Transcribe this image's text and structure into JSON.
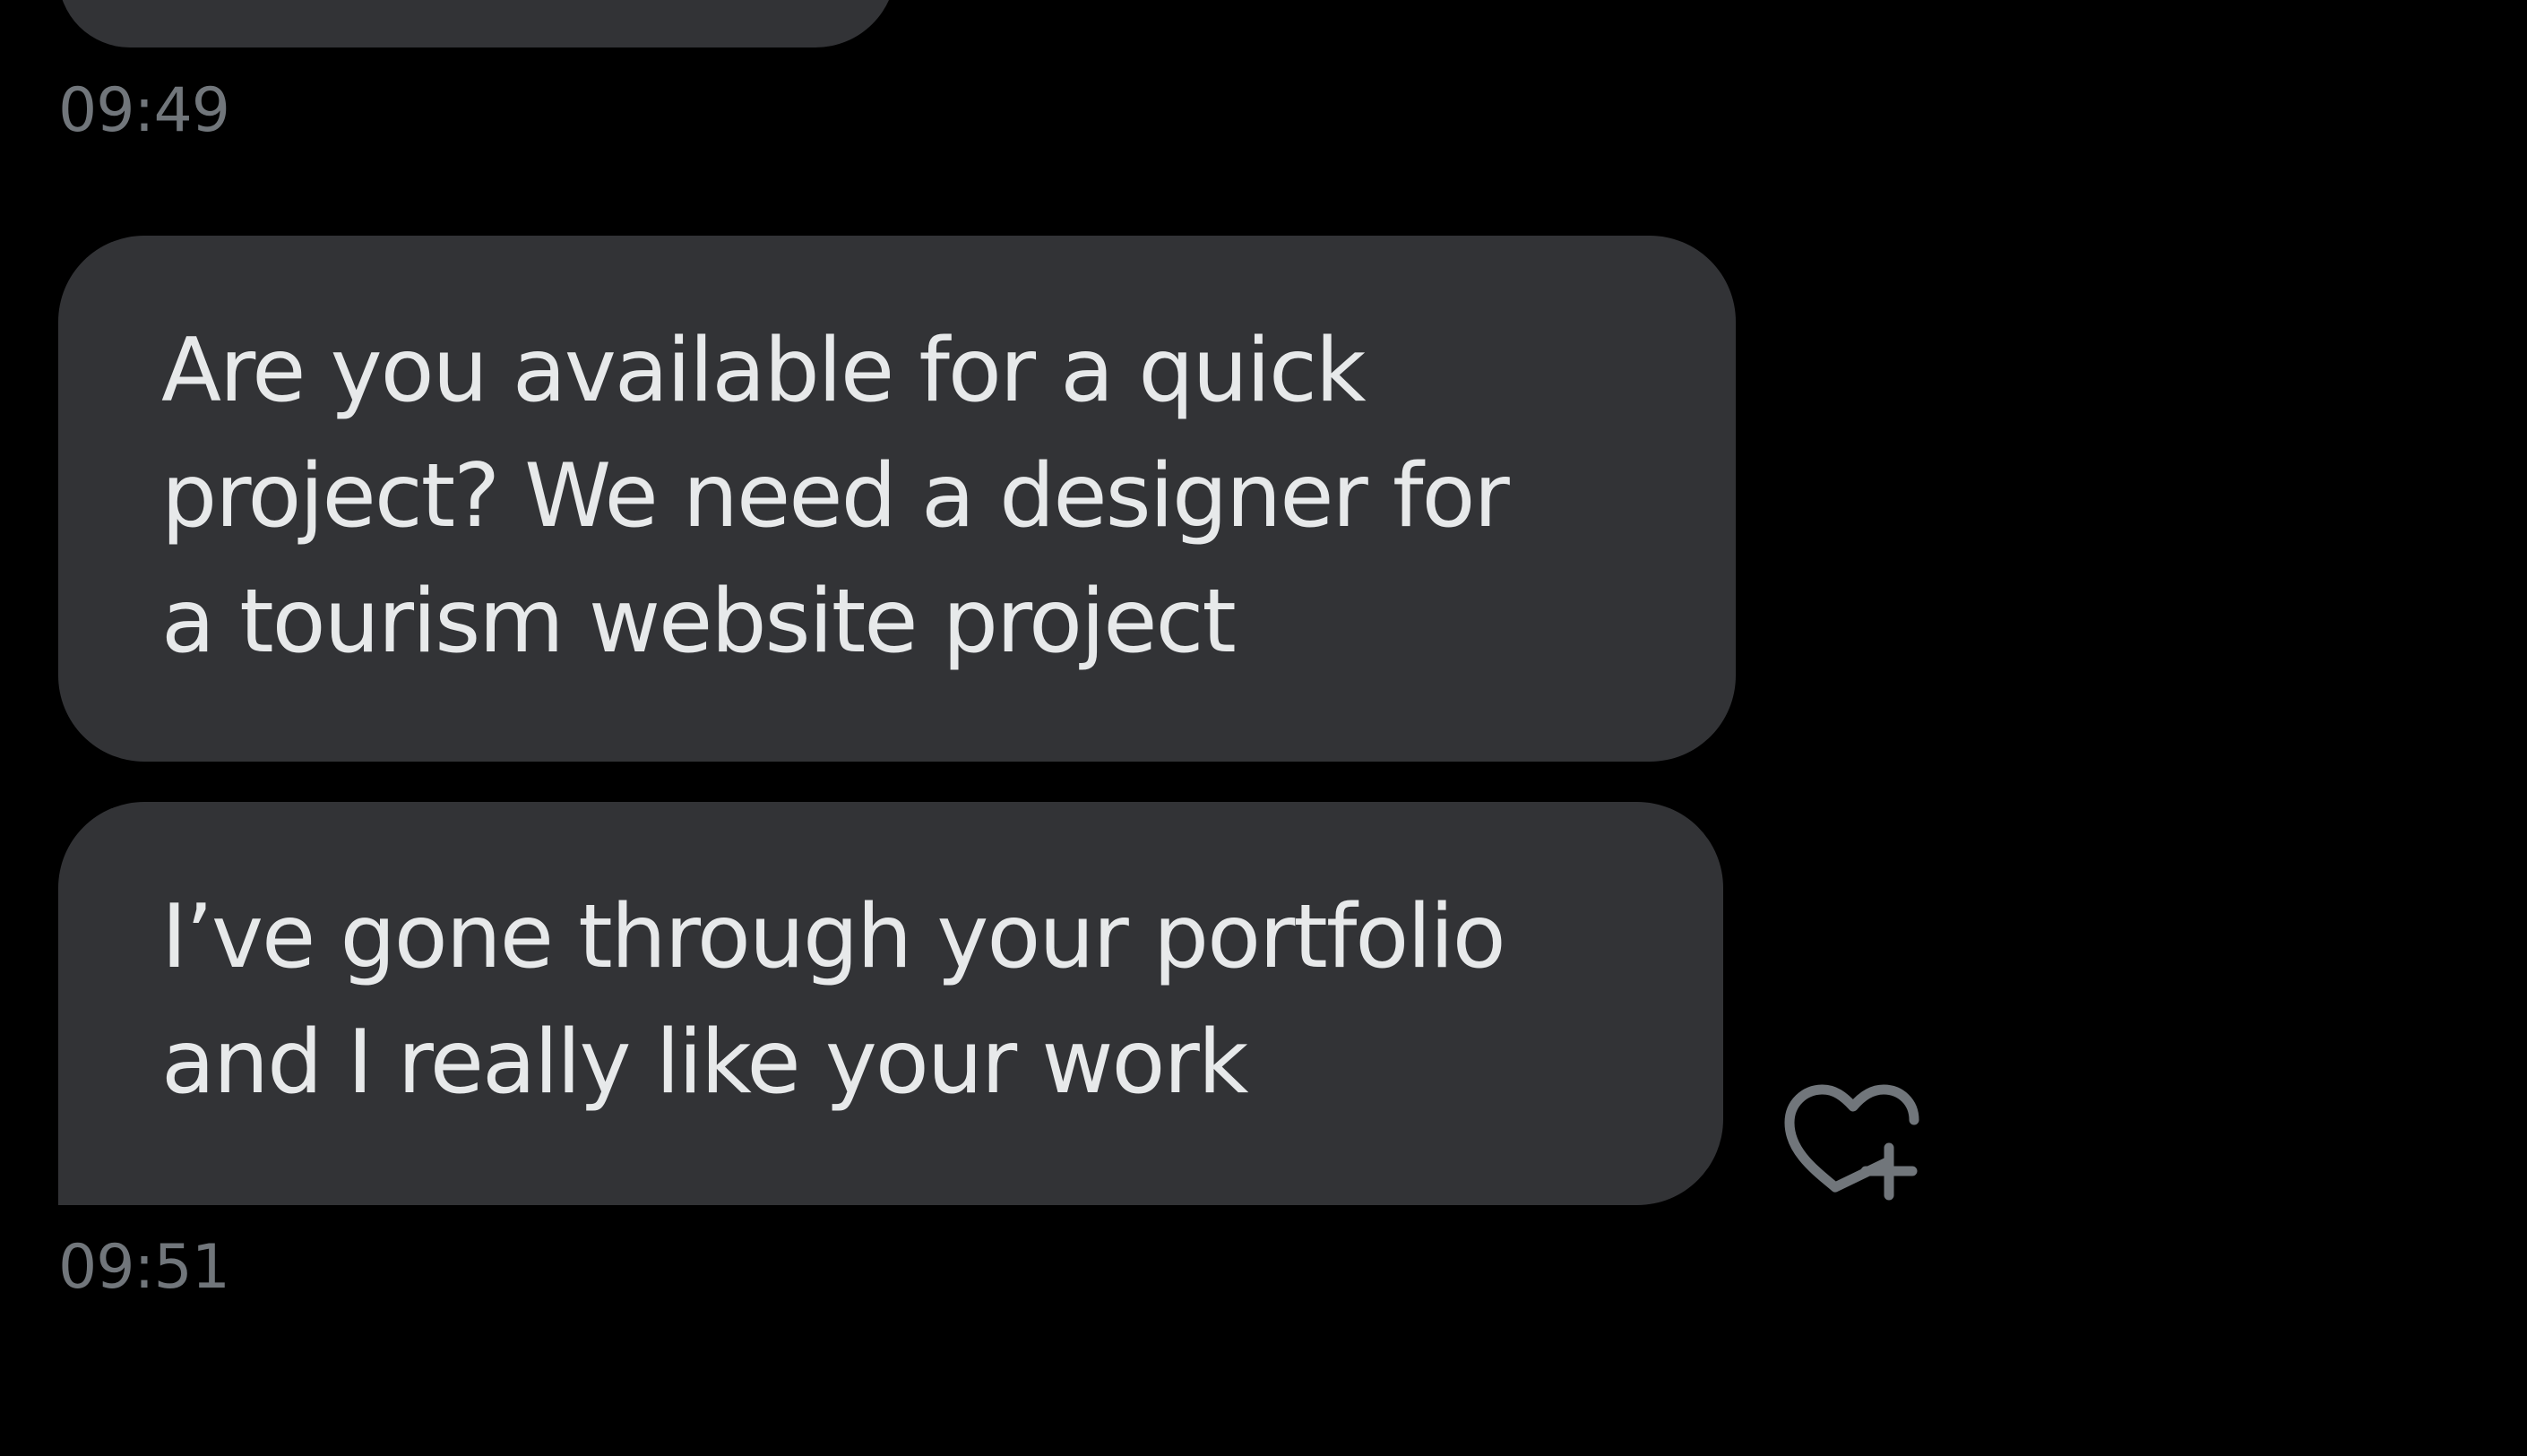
{
  "conversation": {
    "previous_message": {
      "timestamp": "09:49"
    },
    "messages": [
      {
        "lines": [
          "Are you available for a quick",
          "project? We need a designer for",
          "a tourism website project"
        ]
      },
      {
        "lines": [
          "I’ve gone through your portfolio",
          "and I really like your work"
        ]
      }
    ],
    "group_timestamp": "09:51",
    "reaction_icon": "heart-plus-icon"
  },
  "colors": {
    "background": "#000000",
    "bubble": "#323336",
    "message_text": "#e7e9ea",
    "timestamp_text": "#71767b",
    "icon": "#71767b"
  }
}
